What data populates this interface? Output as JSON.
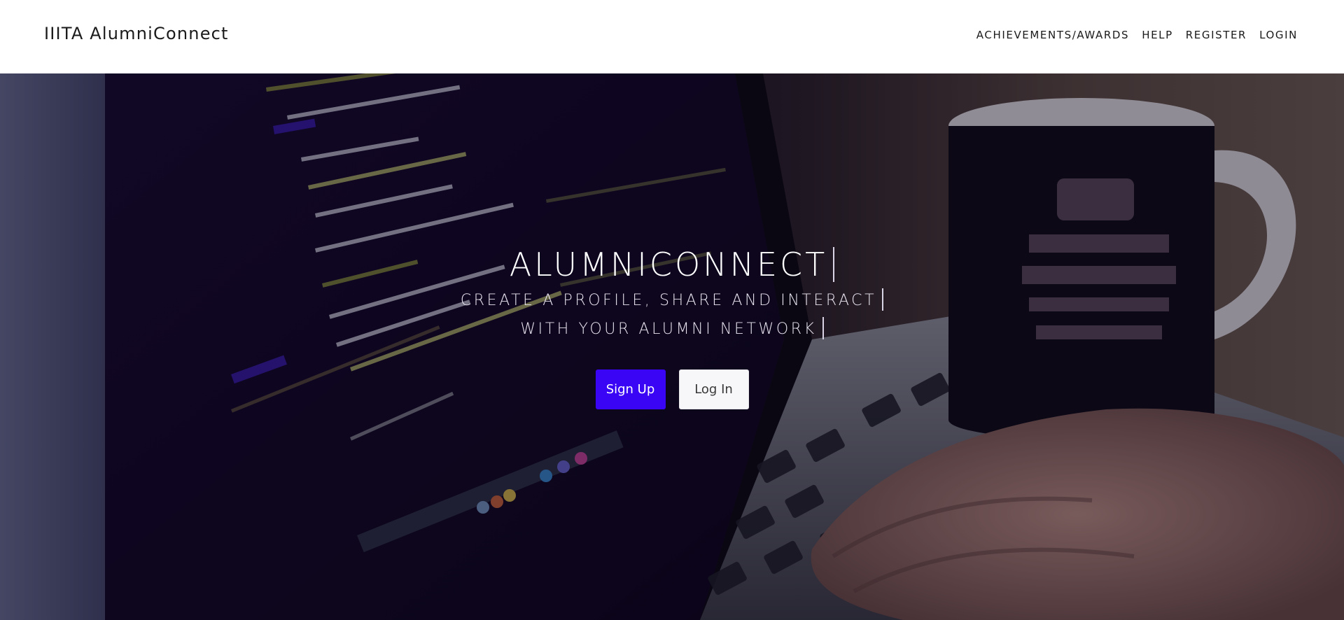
{
  "navbar": {
    "brand": "IIITA AlumniConnect",
    "links": [
      {
        "label": "ACHIEVEMENTS/AWARDS"
      },
      {
        "label": "HELP"
      },
      {
        "label": "REGISTER"
      },
      {
        "label": "LOGIN"
      }
    ]
  },
  "hero": {
    "title": "ALUMNICONNECT",
    "subtitle_line1": "CREATE A PROFILE, SHARE AND INTERACT",
    "subtitle_line2": "WITH YOUR ALUMNI NETWORK",
    "signup_label": "Sign Up",
    "login_label": "Log In",
    "background": "photo of a laptop showing code next to a coffee mug, with a hand on the keyboard"
  },
  "colors": {
    "accent": "#3a05f5",
    "navbar_bg": "#ffffff",
    "overlay": "#0a0419"
  }
}
